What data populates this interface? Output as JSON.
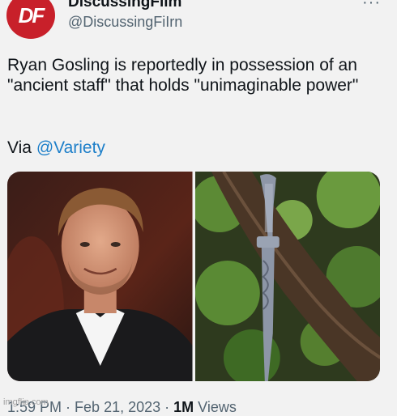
{
  "account": {
    "avatar_text": "DF",
    "name": "DiscussingFilm",
    "handle": "@DiscussingFiIrn"
  },
  "menu": {
    "more_label": "···"
  },
  "tweet": {
    "text": "Ryan Gosling is reportedly in possession of an \"ancient staff\" that holds \"unimaginable power\"",
    "via_prefix": "Via ",
    "via_link": "@Variety"
  },
  "media": {
    "items": [
      {
        "icon": "portrait-photo"
      },
      {
        "icon": "staff-in-tree-photo"
      }
    ]
  },
  "footer": {
    "time": "1:59 PM",
    "date": "Feb 21, 2023",
    "views_count": "1M",
    "views_label": " Views",
    "separator": " · "
  },
  "watermark": {
    "text": "imgflip.com"
  },
  "colors": {
    "background": "#f2f2f2",
    "avatar": "#c8202a",
    "link": "#1d7fc9",
    "secondary_text": "#536471"
  }
}
